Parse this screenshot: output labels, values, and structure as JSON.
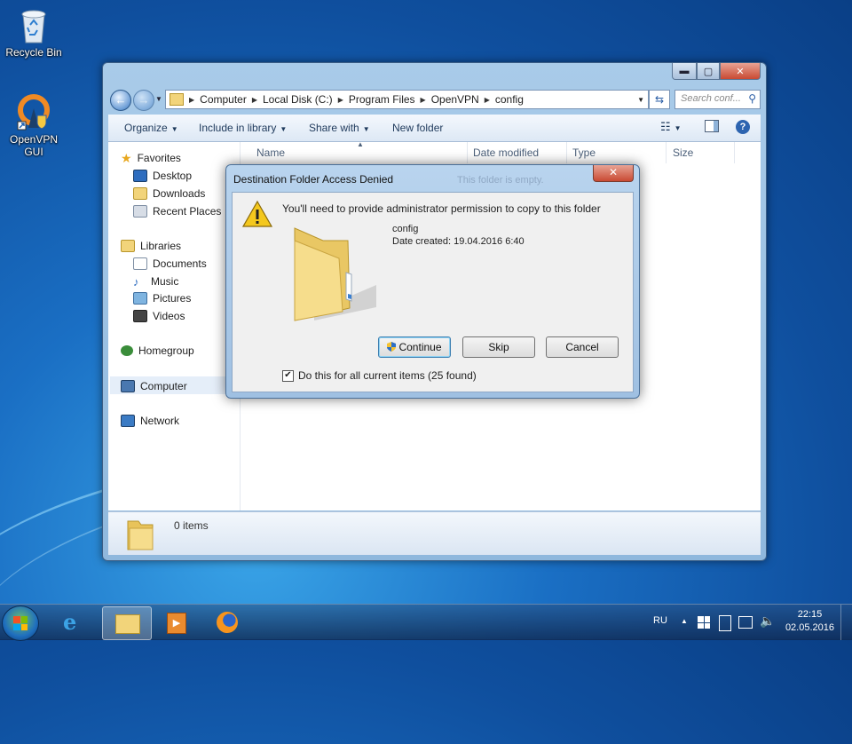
{
  "desktop": {
    "icons": [
      {
        "label": "Recycle Bin",
        "icon": "recycle-bin-icon"
      },
      {
        "label": "OpenVPN GUI",
        "icon": "openvpn-icon"
      }
    ]
  },
  "explorer": {
    "breadcrumb": [
      "Computer",
      "Local Disk (C:)",
      "Program Files",
      "OpenVPN",
      "config"
    ],
    "search_placeholder": "Search conf...",
    "toolbar": {
      "organize": "Organize",
      "include": "Include in library",
      "share": "Share with",
      "new_folder": "New folder"
    },
    "nav": {
      "favorites": "Favorites",
      "desktop": "Desktop",
      "downloads": "Downloads",
      "recent": "Recent Places",
      "libraries": "Libraries",
      "documents": "Documents",
      "music": "Music",
      "pictures": "Pictures",
      "videos": "Videos",
      "homegroup": "Homegroup",
      "computer": "Computer",
      "network": "Network"
    },
    "columns": [
      "Name",
      "Date modified",
      "Type",
      "Size"
    ],
    "empty_message": "This folder is empty.",
    "details": {
      "count": "0 items"
    }
  },
  "dialog": {
    "title": "Destination Folder Access Denied",
    "message": "You'll need to provide administrator permission to copy to this folder",
    "folder_name": "config",
    "date_created": "Date created: 19.04.2016 6:40",
    "buttons": {
      "continue": "Continue",
      "skip": "Skip",
      "cancel": "Cancel"
    },
    "checkbox_label": "Do this for all current items (25 found)",
    "checkbox_checked": true
  },
  "taskbar": {
    "language": "RU",
    "time": "22:15",
    "date": "02.05.2016"
  },
  "colors": {
    "desktop": "#1a6fc4",
    "close_button": "#c94a33",
    "folder": "#f2d47a"
  }
}
